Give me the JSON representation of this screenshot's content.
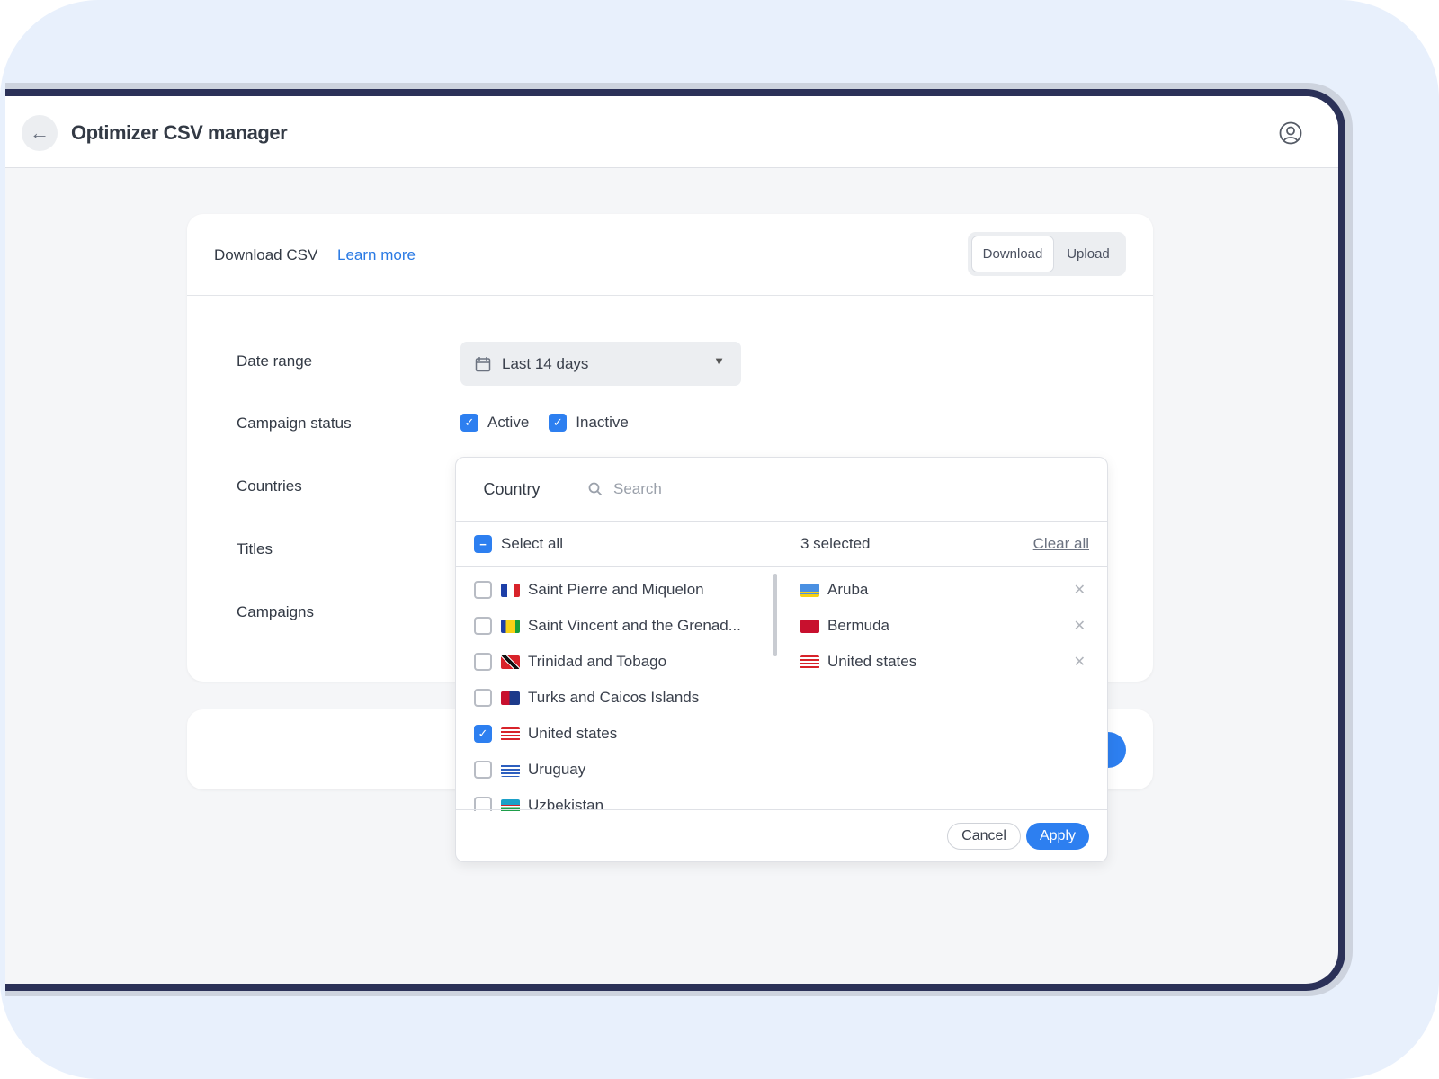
{
  "header": {
    "title": "Optimizer CSV manager",
    "back_icon": "arrow-left-icon",
    "profile_icon": "user-circle-icon"
  },
  "card": {
    "title": "Download CSV",
    "learn_more": "Learn more",
    "mode_toggle": {
      "options": [
        "Download",
        "Upload"
      ],
      "selected": "Download"
    },
    "fields": {
      "date_range": "Date range",
      "campaign_status": "Campaign status",
      "countries": "Countries",
      "titles": "Titles",
      "campaigns": "Campaigns"
    },
    "date_value": "Last 14 days",
    "status_options": [
      {
        "label": "Active",
        "checked": true
      },
      {
        "label": "Inactive",
        "checked": true
      }
    ]
  },
  "country_dropdown": {
    "tab": "Country",
    "search_placeholder": "Search",
    "select_all": "Select all",
    "selected_count": "3 selected",
    "clear_all": "Clear all",
    "items": [
      {
        "label": "Saint Pierre and Miquelon",
        "checked": false
      },
      {
        "label": "Saint Vincent and the Grenad...",
        "checked": false
      },
      {
        "label": "Trinidad and Tobago",
        "checked": false
      },
      {
        "label": "Turks and Caicos Islands",
        "checked": false
      },
      {
        "label": "United states",
        "checked": true
      },
      {
        "label": "Uruguay",
        "checked": false
      },
      {
        "label": "Uzbekistan",
        "checked": false
      }
    ],
    "selected": [
      {
        "label": "Aruba"
      },
      {
        "label": "Bermuda"
      },
      {
        "label": "United states"
      }
    ],
    "cancel": "Cancel",
    "apply": "Apply"
  },
  "colors": {
    "accent": "#2d7ff0",
    "link": "#2a7ae4",
    "frame": "#2b3158",
    "background": "#e8f0fc"
  }
}
